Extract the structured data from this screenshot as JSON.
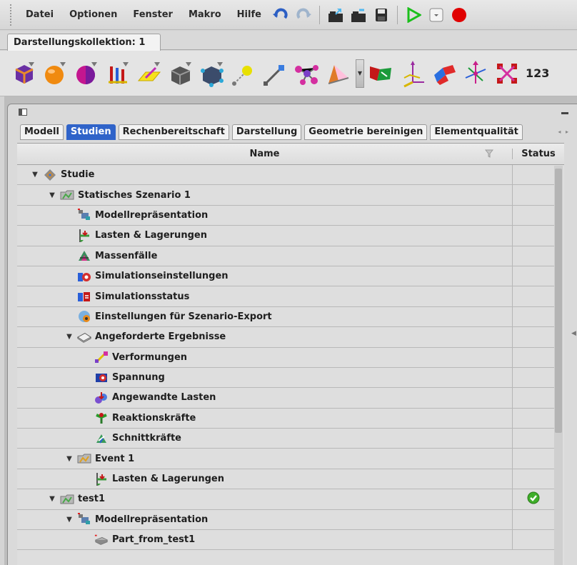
{
  "menubar": {
    "items": [
      "Datei",
      "Optionen",
      "Fenster",
      "Makro",
      "Hilfe"
    ]
  },
  "collection_tab": "Darstellungskollektion: 1",
  "iconbar": {
    "more_label": "123"
  },
  "panel": {
    "tabs": [
      "Modell",
      "Studien",
      "Rechenbereitschaft",
      "Darstellung",
      "Geometrie bereinigen",
      "Elementqualität"
    ],
    "active_tab": "Studien"
  },
  "table": {
    "columns": {
      "name": "Name",
      "status": "Status"
    },
    "rows": [
      {
        "label": "Studie",
        "level": 0,
        "toggle": "▼",
        "icon": "study-icon"
      },
      {
        "label": "Statisches Szenario 1",
        "level": 1,
        "toggle": "▼",
        "icon": "scenario-icon"
      },
      {
        "label": "Modellrepräsentation",
        "level": 2,
        "toggle": "",
        "icon": "model-representation-icon"
      },
      {
        "label": "Lasten & Lagerungen",
        "level": 2,
        "toggle": "",
        "icon": "loads-supports-icon"
      },
      {
        "label": "Massenfälle",
        "level": 2,
        "toggle": "",
        "icon": "mass-cases-icon"
      },
      {
        "label": "Simulationseinstellungen",
        "level": 2,
        "toggle": "",
        "icon": "simulation-settings-icon"
      },
      {
        "label": "Simulationsstatus",
        "level": 2,
        "toggle": "",
        "icon": "simulation-status-icon"
      },
      {
        "label": "Einstellungen für Szenario-Export",
        "level": 2,
        "toggle": "",
        "icon": "export-settings-icon"
      },
      {
        "label": "Angeforderte Ergebnisse",
        "level": 2,
        "toggle": "▼",
        "icon": "requested-results-icon"
      },
      {
        "label": "Verformungen",
        "level": 3,
        "toggle": "",
        "icon": "deformation-icon"
      },
      {
        "label": "Spannung",
        "level": 3,
        "toggle": "",
        "icon": "stress-icon"
      },
      {
        "label": "Angewandte Lasten",
        "level": 3,
        "toggle": "",
        "icon": "applied-loads-icon"
      },
      {
        "label": "Reaktionskräfte",
        "level": 3,
        "toggle": "",
        "icon": "reaction-forces-icon"
      },
      {
        "label": "Schnittkräfte",
        "level": 3,
        "toggle": "",
        "icon": "section-forces-icon"
      },
      {
        "label": "Event 1",
        "level": 2,
        "toggle": "▼",
        "icon": "event-icon"
      },
      {
        "label": "Lasten & Lagerungen",
        "level": 3,
        "toggle": "",
        "icon": "loads-supports-icon"
      },
      {
        "label": "test1",
        "level": 1,
        "toggle": "▼",
        "icon": "scenario-icon",
        "status": "ok-check-icon"
      },
      {
        "label": "Modellrepräsentation",
        "level": 2,
        "toggle": "▼",
        "icon": "model-representation-icon"
      },
      {
        "label": "Part_from_test1",
        "level": 3,
        "toggle": "",
        "icon": "part-icon"
      }
    ]
  },
  "colors": {
    "active_tab": "#2f63c9",
    "status_ok": "#3fae2a",
    "record_red": "#e00000",
    "play_green": "#1bbf1b"
  }
}
